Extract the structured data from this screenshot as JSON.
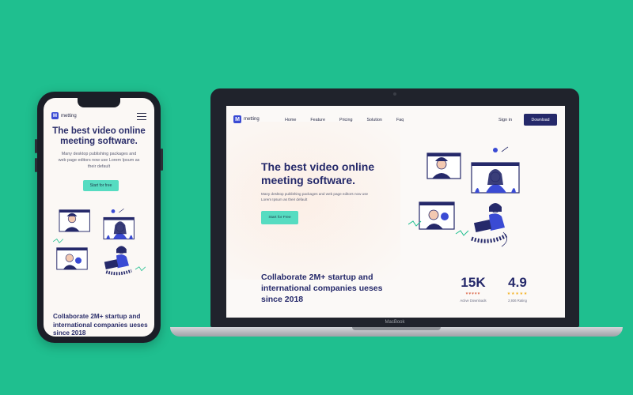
{
  "brand": {
    "name": "metting",
    "logo_letter": "M",
    "color": "#3a4bd4"
  },
  "colors": {
    "background": "#1fbf8f",
    "accent": "#56dcc1",
    "primary": "#25296a",
    "star_hearts": "#e07a5f",
    "star": "#f4b42a"
  },
  "desktop": {
    "nav": {
      "links": [
        "Home",
        "Feature",
        "Pricing",
        "Solution",
        "Faq"
      ],
      "signin": "Sign in",
      "download": "Download"
    },
    "hero": {
      "title": "The best video online meeting software.",
      "description": "Many desktop publishing packages and web page editors now use Lorem Ipsum as their default",
      "cta": "Start for Free"
    },
    "tagline": "Collaborate 2M+ startup and international companies ueses since 2018",
    "stats": [
      {
        "value": "15K",
        "stars": "♥♥♥♥♥",
        "label": "Active Downloads"
      },
      {
        "value": "4.9",
        "stars": "★★★★★",
        "label": "2,936 Rating"
      }
    ]
  },
  "mobile": {
    "title": "The best video online meeting software.",
    "description": "Many desktop publishing packages and web page editors now use Lorem Ipsum as their default",
    "cta": "Start for free",
    "tagline": "Collaborate 2M+ startup and international companies ueses since 2018"
  },
  "device": {
    "laptop_label": "MacBook"
  },
  "icons": {
    "menu": "hamburger-icon",
    "logo": "logo-icon"
  }
}
